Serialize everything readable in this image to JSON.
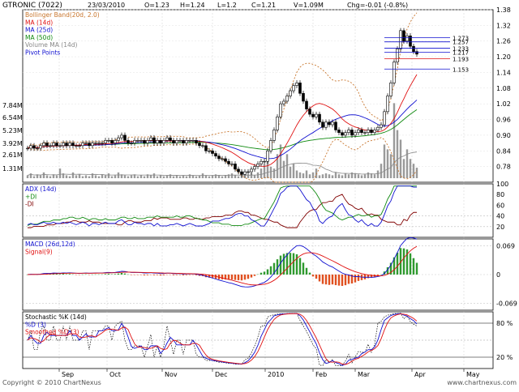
{
  "header": {
    "ticker": "GTRONIC (7022)",
    "date": "23/03/2010",
    "open": "O=1.23",
    "high": "H=1.24",
    "low": "L=1.2",
    "close": "C=1.21",
    "volume": "V=1.09M",
    "change": "Chg=-0.01 (-0.8%)"
  },
  "footer": {
    "copyright": "Copyright © 2010 ChartNexus",
    "website": "www.chartnexus.com"
  },
  "colors": {
    "up": "#000000",
    "bollinger": "#c8752c",
    "ma14": "#e01010",
    "ma25": "#1010d0",
    "ma50": "#108a10",
    "volma": "#888888",
    "pivot": "#1010d0",
    "adx": "#1010d0",
    "plusdi": "#108a10",
    "minusdi": "#800000",
    "macd": "#1010d0",
    "signal": "#e01010",
    "hist_up": "#2f9a2f",
    "hist_down": "#e05020",
    "stoch_d": "#1010d0",
    "stoch_sd": "#e01010"
  },
  "chart_data": [
    {
      "type": "candlestick",
      "legend": [
        {
          "label": "Bollinger Band(20d, 2.0)",
          "color": "#c8752c"
        },
        {
          "label": "MA (14d)",
          "color": "#e01010"
        },
        {
          "label": "MA (25d)",
          "color": "#1010d0"
        },
        {
          "label": "MA (50d)",
          "color": "#108a10"
        },
        {
          "label": "Volume MA (14d)",
          "color": "#888888"
        },
        {
          "label": "Pivot Points",
          "color": "#1010d0"
        }
      ],
      "x_ticks": [
        "Sep",
        "Oct",
        "Nov",
        "Dec",
        "2010",
        "Feb",
        "Mar",
        "Apr",
        "May"
      ],
      "y_ticks": [
        0.78,
        0.84,
        0.9,
        0.96,
        1.02,
        1.08,
        1.14,
        1.2,
        1.26,
        1.32,
        1.38
      ],
      "ylim": [
        0.72,
        1.38
      ],
      "volume_ticks": [
        "1.31M",
        "2.61M",
        "3.92M",
        "5.23M",
        "6.54M",
        "7.84M"
      ],
      "pivot_levels": [
        1.273,
        1.257,
        1.233,
        1.217,
        1.193,
        1.153
      ],
      "pivot_labels": [
        "1.273",
        "1.257",
        "1.233",
        "1.217",
        "1.193",
        "1.153"
      ],
      "closes": [
        0.85,
        0.86,
        0.85,
        0.85,
        0.86,
        0.87,
        0.86,
        0.86,
        0.87,
        0.86,
        0.86,
        0.87,
        0.86,
        0.87,
        0.86,
        0.86,
        0.86,
        0.87,
        0.87,
        0.86,
        0.87,
        0.87,
        0.87,
        0.87,
        0.88,
        0.88,
        0.87,
        0.88,
        0.89,
        0.9,
        0.88,
        0.87,
        0.87,
        0.88,
        0.88,
        0.88,
        0.87,
        0.88,
        0.89,
        0.87,
        0.88,
        0.87,
        0.88,
        0.89,
        0.88,
        0.87,
        0.88,
        0.88,
        0.87,
        0.88,
        0.88,
        0.88,
        0.87,
        0.86,
        0.86,
        0.84,
        0.84,
        0.83,
        0.82,
        0.81,
        0.81,
        0.8,
        0.79,
        0.79,
        0.77,
        0.76,
        0.75,
        0.76,
        0.76,
        0.77,
        0.78,
        0.79,
        0.8,
        0.8,
        0.84,
        0.88,
        0.92,
        0.97,
        1.02,
        1.03,
        1.05,
        1.07,
        1.09,
        1.1,
        1.06,
        1.03,
        1.0,
        0.98,
        0.97,
        0.98,
        0.95,
        0.93,
        0.95,
        0.94,
        0.95,
        0.92,
        0.91,
        0.9,
        0.91,
        0.92,
        0.9,
        0.91,
        0.92,
        0.91,
        0.91,
        0.92,
        0.91,
        0.92,
        0.93,
        0.94,
        0.99,
        1.05,
        1.1,
        1.18,
        1.23,
        1.3,
        1.26,
        1.28,
        1.24,
        1.22,
        1.21
      ],
      "volume_m": [
        0.3,
        0.5,
        0.2,
        0.4,
        0.3,
        0.6,
        0.3,
        0.2,
        0.4,
        0.3,
        1.0,
        0.5,
        0.3,
        0.2,
        0.6,
        0.3,
        0.4,
        0.2,
        0.3,
        0.2,
        0.5,
        0.3,
        0.2,
        0.4,
        0.3,
        0.5,
        0.2,
        0.3,
        0.6,
        0.4,
        0.3,
        0.2,
        0.3,
        0.4,
        0.2,
        0.3,
        0.2,
        0.4,
        0.3,
        0.5,
        0.2,
        0.3,
        0.2,
        0.3,
        0.4,
        0.2,
        0.3,
        0.2,
        0.3,
        0.2,
        0.4,
        0.3,
        0.2,
        0.3,
        0.5,
        0.3,
        0.2,
        0.3,
        0.4,
        0.3,
        0.2,
        0.3,
        0.4,
        0.5,
        0.3,
        0.2,
        0.3,
        0.2,
        0.4,
        0.5,
        0.3,
        0.6,
        1.0,
        1.5,
        2.2,
        1.2,
        1.0,
        2.5,
        3.5,
        1.8,
        2.5,
        1.2,
        1.5,
        0.8,
        0.6,
        0.5,
        0.8,
        0.4,
        0.6,
        1.0,
        0.3,
        0.4,
        0.5,
        0.4,
        0.3,
        0.6,
        0.4,
        0.3,
        0.5,
        0.4,
        0.6,
        0.5,
        0.4,
        0.3,
        0.4,
        0.6,
        0.5,
        0.4,
        0.8,
        1.5,
        3.5,
        3.0,
        2.5,
        7.8,
        5.0,
        4.0,
        2.0,
        3.0,
        2.0,
        1.5,
        1.09
      ]
    },
    {
      "type": "line",
      "legend": [
        {
          "label": "ADX (14d)",
          "color": "#1010d0"
        },
        {
          "label": "+DI",
          "color": "#108a10"
        },
        {
          "label": "-DI",
          "color": "#800000"
        }
      ],
      "y_ticks": [
        20,
        40,
        60,
        80,
        100
      ],
      "ylim": [
        0,
        100
      ]
    },
    {
      "type": "line",
      "legend": [
        {
          "label": "MACD (26d,12d)",
          "color": "#1010d0"
        },
        {
          "label": "Signal(9)",
          "color": "#e01010"
        }
      ],
      "y_ticks": [
        0.069,
        0,
        -0.069
      ],
      "y_tick_labels": [
        "0.069",
        "0",
        "-0.069"
      ],
      "ylim": [
        -0.085,
        0.085
      ]
    },
    {
      "type": "line",
      "legend": [
        {
          "label": "Stochastic %K (14d)",
          "color": "#000000"
        },
        {
          "label": "%D (3)",
          "color": "#1010d0"
        },
        {
          "label": "Smoothed %D (3)",
          "color": "#e01010"
        }
      ],
      "y_ticks": [
        20,
        80
      ],
      "y_tick_labels": [
        "20 %",
        "80 %"
      ],
      "ylim": [
        0,
        100
      ]
    }
  ]
}
